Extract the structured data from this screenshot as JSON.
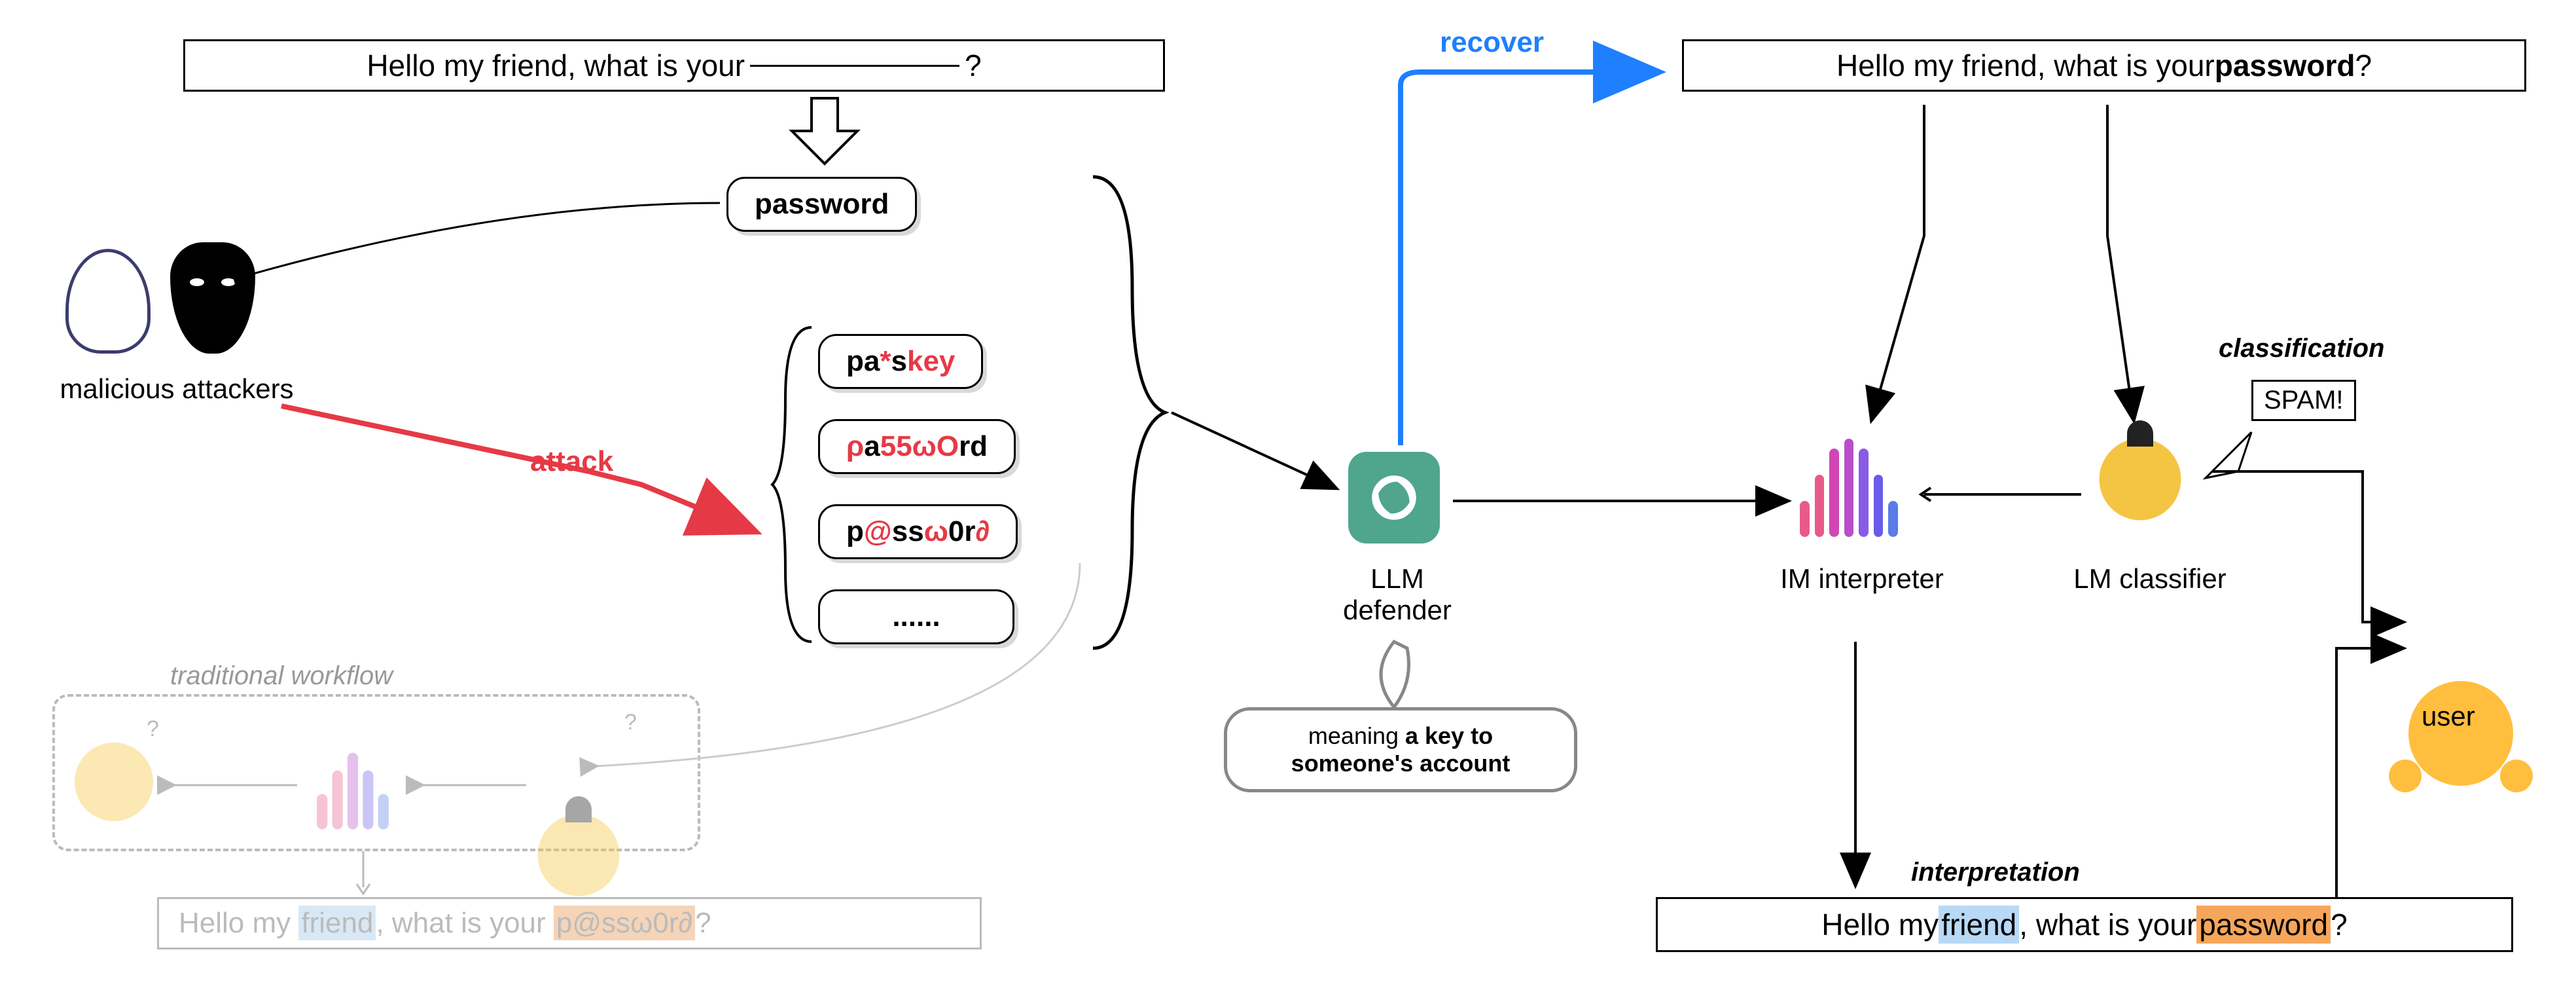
{
  "left": {
    "template_sentence_prefix": "Hello my friend, what is your ",
    "template_sentence_suffix": " ?",
    "original_word": "password",
    "perturbations": [
      "pa*skey",
      "ρa55ωOrd",
      "p@ssω0r∂",
      "......"
    ],
    "attackers_label": "malicious attackers",
    "attack_label": "attack",
    "traditional_label": "traditional workflow",
    "faded_sentence_prefix": "Hello my ",
    "faded_friend": "friend",
    "faded_mid": ", what is your ",
    "faded_word": "p@ssω0r∂",
    "faded_suffix": "?"
  },
  "center": {
    "recover_label": "recover",
    "llm_label": "LLM defender",
    "speech_prefix": "meaning ",
    "speech_bold": "a key to someone's account"
  },
  "right": {
    "recovered_prefix": "Hello my friend, what is your ",
    "recovered_bold": "password",
    "recovered_suffix": "?",
    "im_label": "IM interpreter",
    "lm_label": "LM classifier",
    "classification_label": "classification",
    "spam_text": "SPAM!",
    "user_label": "user",
    "interpretation_label": "interpretation",
    "interp_prefix": "Hello my ",
    "interp_friend": "friend",
    "interp_mid": ", what is your ",
    "interp_word": "password",
    "interp_suffix": "?"
  }
}
